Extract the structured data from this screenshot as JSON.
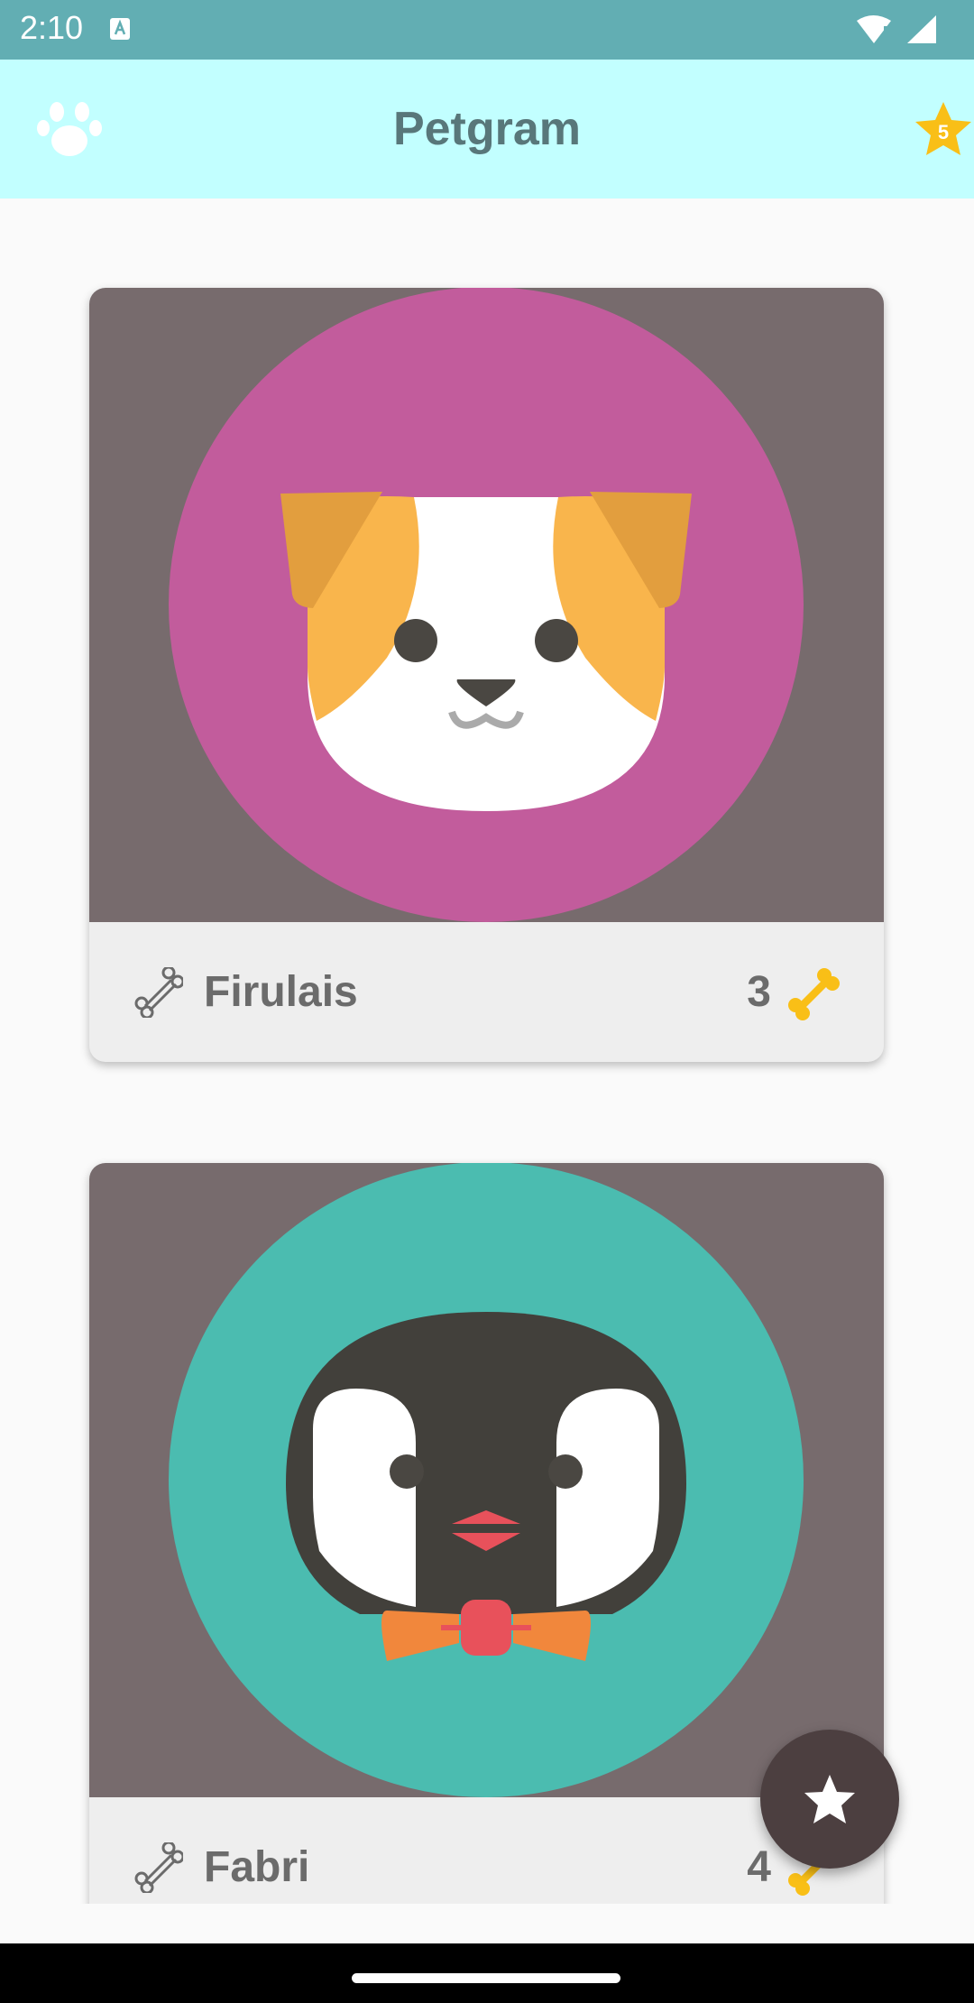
{
  "status_bar": {
    "time": "2:10",
    "notification_icon": "accessibility-a-icon",
    "right_icons": [
      "wifi-icon",
      "signal-icon"
    ]
  },
  "app_bar": {
    "title": "Petgram",
    "left_icon": "paw-icon",
    "right_icon": "star-badge-icon",
    "star_count": "5"
  },
  "posts": [
    {
      "name": "Firulais",
      "likes": "3",
      "image": "dog-avatar",
      "image_bg_color": "#c25c9c"
    },
    {
      "name": "Fabri",
      "likes": "4",
      "image": "penguin-avatar",
      "image_bg_color": "#4bbcb0"
    }
  ],
  "fab": {
    "icon": "star-icon"
  },
  "colors": {
    "status_bar": "#62aeb3",
    "app_bar": "#c2ffff",
    "title_text": "#58777a",
    "card_image_bg": "#776b6d",
    "card_footer": "#eeeeee",
    "bone_accent": "#f9bf17",
    "fab": "#4c3f40"
  }
}
